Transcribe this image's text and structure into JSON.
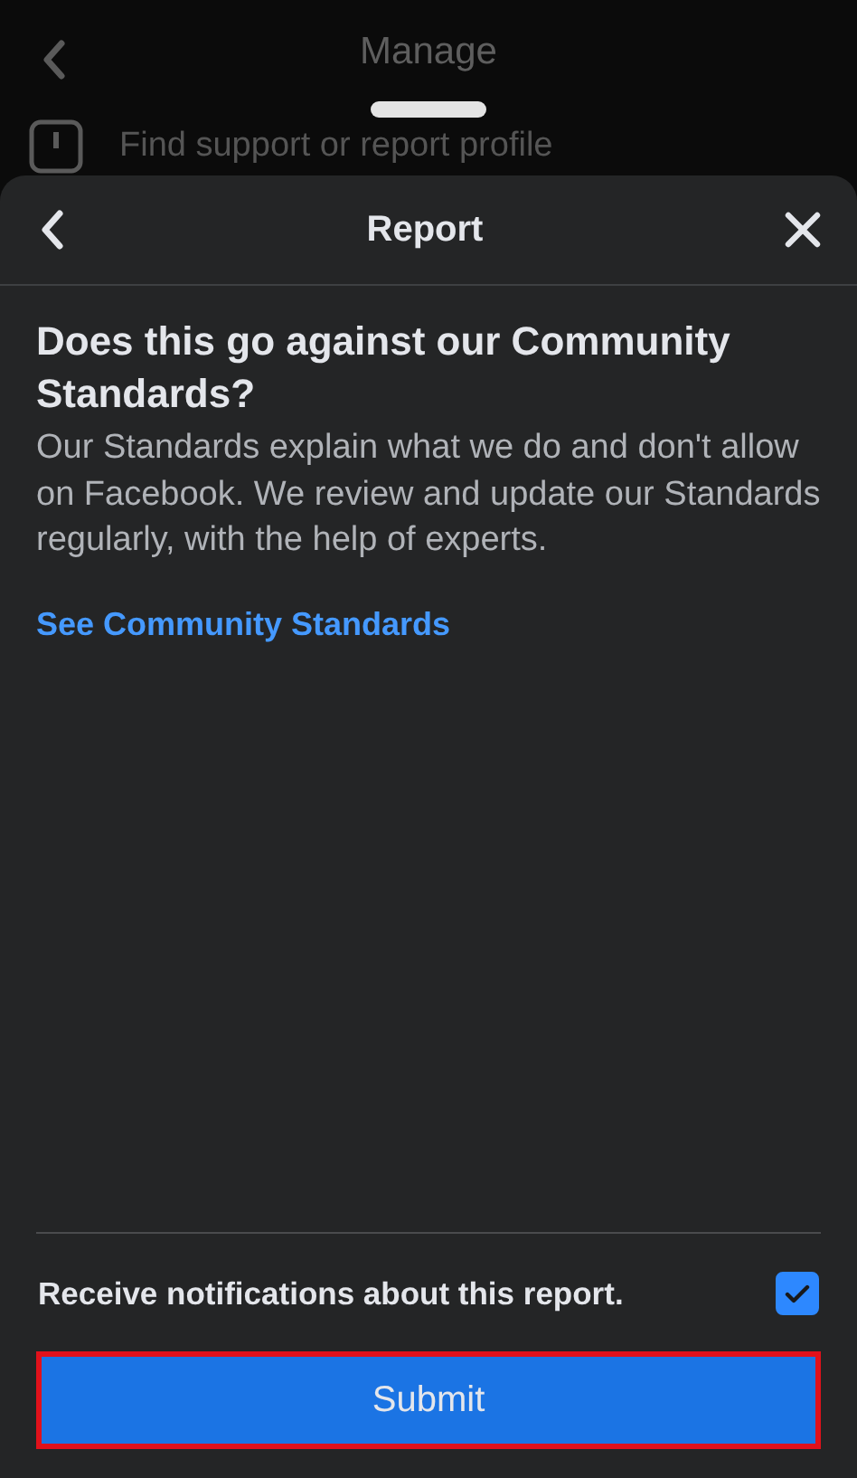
{
  "background_screen": {
    "title": "Manage",
    "list_item": "Find support or report profile"
  },
  "sheet": {
    "title": "Report",
    "heading": "Does this go against our Community Standards?",
    "body": "Our Standards explain what we do and don't allow on Facebook. We review and update our Standards regularly, with the help of experts.",
    "link": "See Community Standards",
    "notifications": {
      "label": "Receive notifications about this report.",
      "checked": true
    },
    "submit": {
      "label": "Submit",
      "highlighted": true
    }
  }
}
